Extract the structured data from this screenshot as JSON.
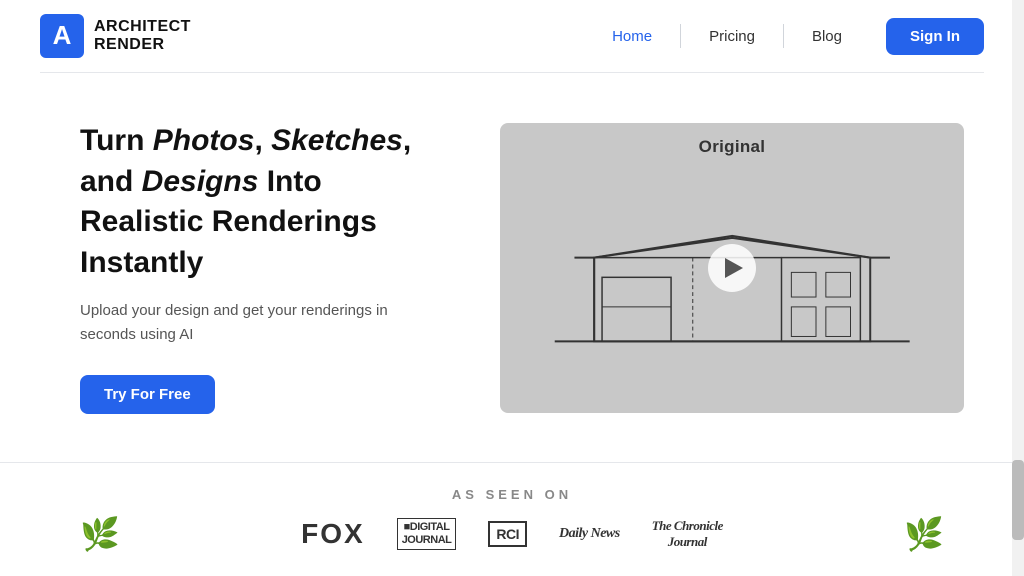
{
  "brand": {
    "name_line1": "ARCHITECT",
    "name_line2": "RENDER"
  },
  "nav": {
    "home_label": "Home",
    "pricing_label": "Pricing",
    "blog_label": "Blog",
    "signin_label": "Sign In"
  },
  "hero": {
    "title_prefix": "Turn ",
    "title_italic1": "Photos",
    "title_comma1": ", ",
    "title_italic2": "Sketches",
    "title_comma2": ",",
    "title_line2": "and ",
    "title_italic3": "Designs",
    "title_suffix": " Into",
    "title_line3": "Realistic Renderings",
    "title_line4": "Instantly",
    "subtitle": "Upload your design and get your renderings in seconds using AI",
    "cta_label": "Try For Free",
    "media_label": "Original"
  },
  "as_seen_on": {
    "title": "AS SEEN ON",
    "logos": [
      {
        "text": "FOX",
        "style": "fox"
      },
      {
        "text": "■DIGITAL\nJOURNAL",
        "style": "digital"
      },
      {
        "text": "RCI",
        "style": "rci"
      },
      {
        "text": "Daily News",
        "style": "daily-news"
      },
      {
        "text": "The Chronicle\nJournal",
        "style": "chronicle"
      }
    ]
  },
  "colors": {
    "accent": "#2563EB"
  }
}
